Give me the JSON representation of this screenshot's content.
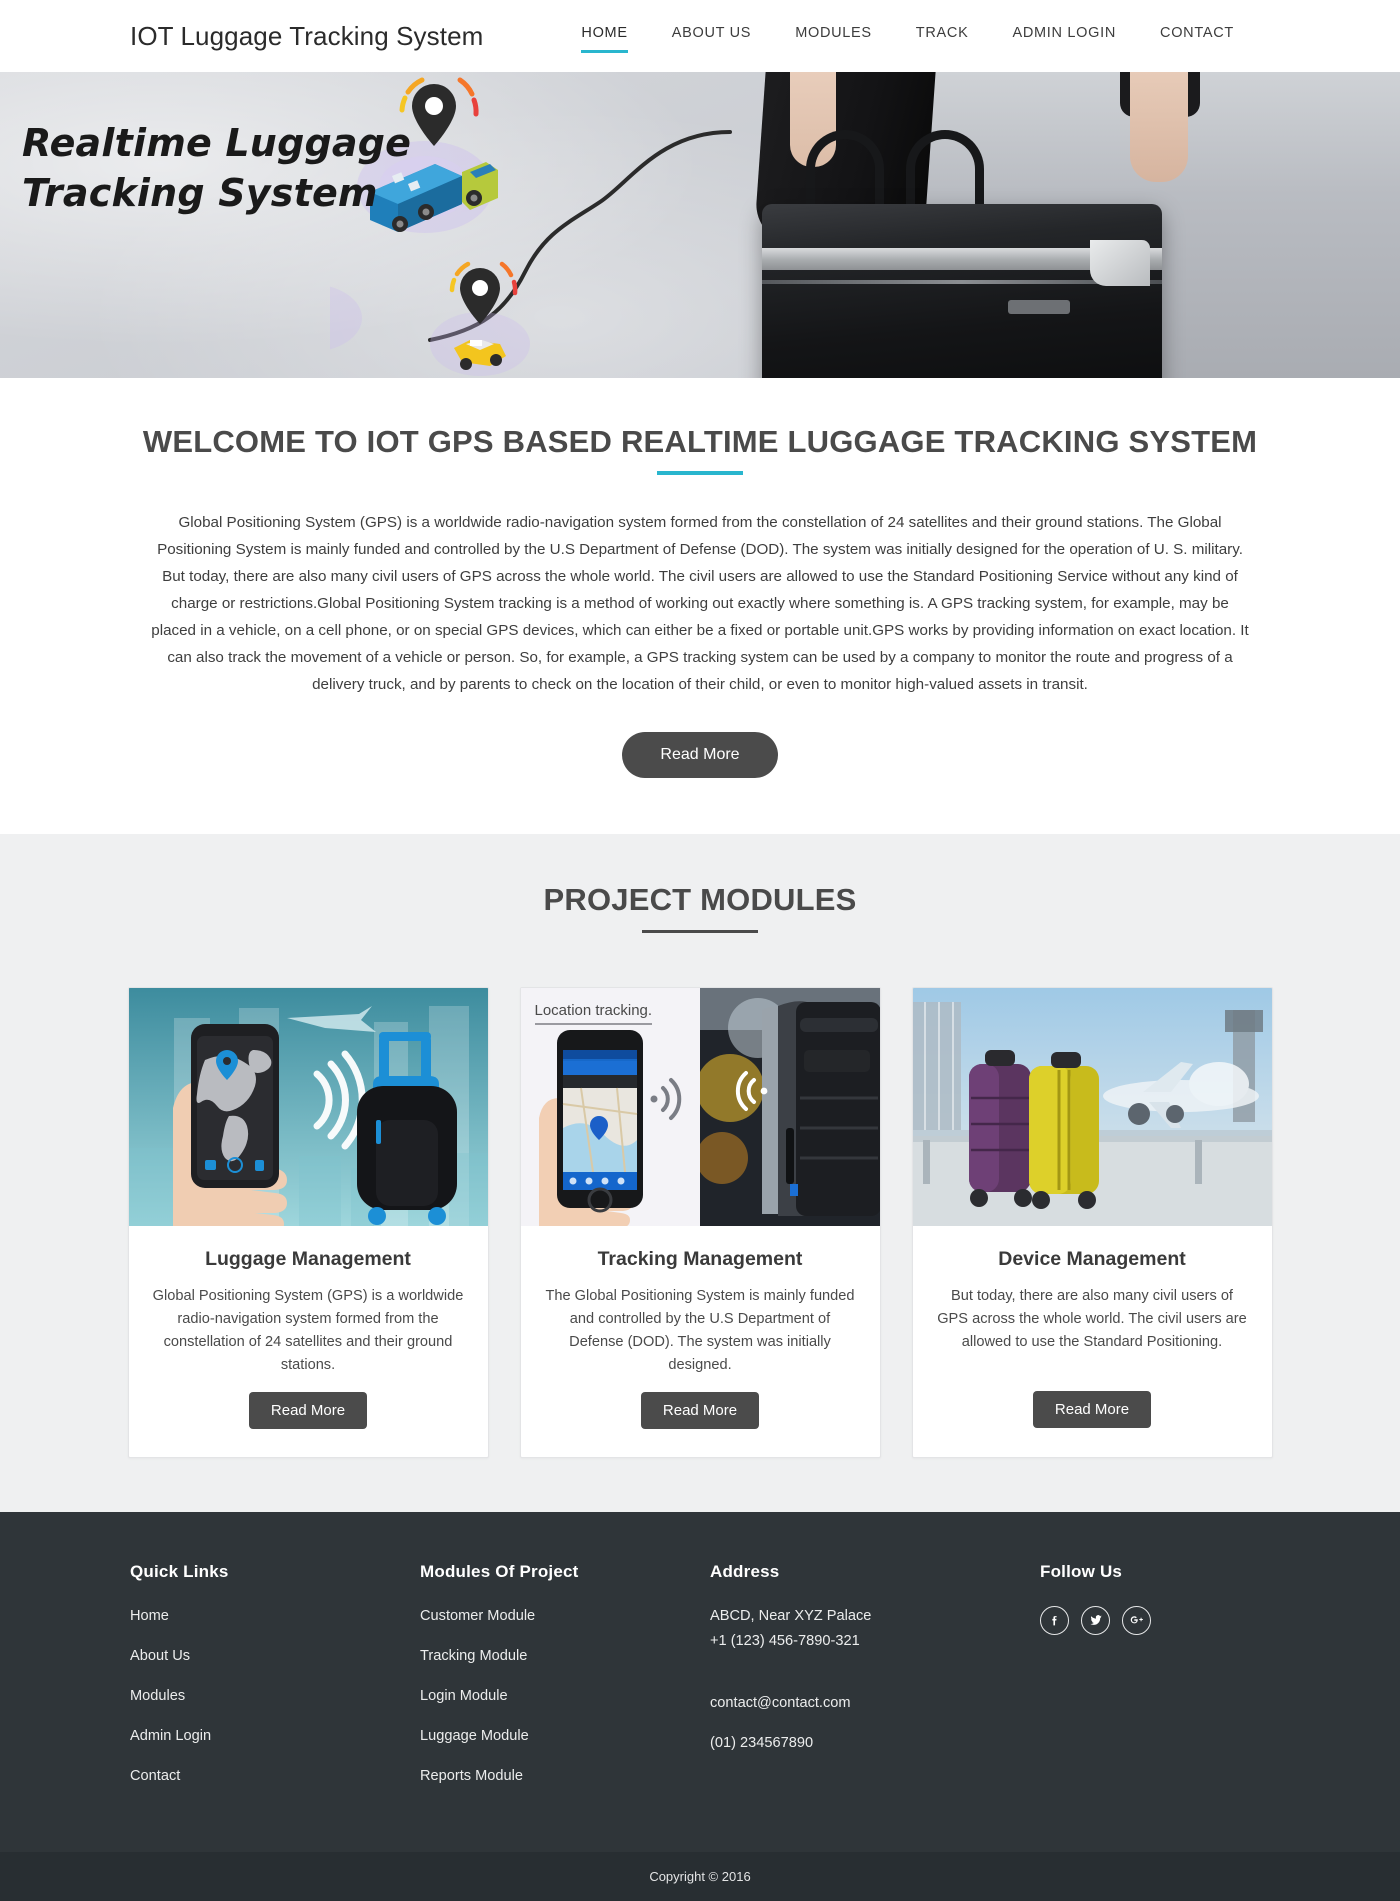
{
  "header": {
    "brand": "IOT Luggage Tracking System",
    "nav": [
      {
        "label": "HOME",
        "active": true
      },
      {
        "label": "ABOUT US",
        "active": false
      },
      {
        "label": "MODULES",
        "active": false
      },
      {
        "label": "TRACK",
        "active": false
      },
      {
        "label": "ADMIN LOGIN",
        "active": false
      },
      {
        "label": "CONTACT",
        "active": false
      }
    ]
  },
  "hero": {
    "title_line1": "Realtime Luggage",
    "title_line2": "Tracking System"
  },
  "welcome": {
    "title": "WELCOME TO IOT GPS BASED REALTIME LUGGAGE TRACKING SYSTEM",
    "body": "Global Positioning System (GPS) is a worldwide radio-navigation system formed from the constellation of 24 satellites and their ground stations. The Global Positioning System is mainly funded and controlled by the U.S Department of Defense (DOD). The system was initially designed for the operation of U. S. military. But today, there are also many civil users of GPS across the whole world. The civil users are allowed to use the Standard Positioning Service without any kind of charge or restrictions.Global Positioning System tracking is a method of working out exactly where something is. A GPS tracking system, for example, may be placed in a vehicle, on a cell phone, or on special GPS devices, which can either be a fixed or portable unit.GPS works by providing information on exact location. It can also track the movement of a vehicle or person. So, for example, a GPS tracking system can be used by a company to monitor the route and progress of a delivery truck, and by parents to check on the location of their child, or even to monitor high-valued assets in transit.",
    "read_more": "Read More"
  },
  "modules": {
    "title": "PROJECT MODULES",
    "cards": [
      {
        "title": "Luggage Management",
        "text": "Global Positioning System (GPS) is a worldwide radio-navigation system formed from the constellation of 24 satellites and their ground stations.",
        "button": "Read More",
        "image_name": "phone-map-and-black-suitcase-illustration"
      },
      {
        "title": "Tracking Management",
        "text": "The Global Positioning System is mainly funded and controlled by the U.S Department of Defense (DOD). The system was initially designed.",
        "button": "Read More",
        "image_name": "location-tracking-phone-and-suitcase-photo",
        "image_caption": "Location tracking."
      },
      {
        "title": "Device Management",
        "text": "But today, there are also many civil users of GPS across the whole world. The civil users are allowed to use the Standard Positioning.",
        "button": "Read More",
        "image_name": "two-suitcases-at-airport-photo"
      }
    ]
  },
  "footer": {
    "quick_links": {
      "heading": "Quick Links",
      "items": [
        "Home",
        "About Us",
        "Modules",
        "Admin Login",
        "Contact"
      ]
    },
    "project_modules": {
      "heading": "Modules Of Project",
      "items": [
        "Customer Module",
        "Tracking Module",
        "Login Module",
        "Luggage Module",
        "Reports Module"
      ]
    },
    "address": {
      "heading": "Address",
      "line1": "ABCD, Near XYZ Palace",
      "line2": "+1 (123) 456-7890-321",
      "email": "contact@contact.com",
      "phone": "(01) 234567890"
    },
    "follow": {
      "heading": "Follow Us",
      "socials": [
        "facebook-icon",
        "twitter-icon",
        "google-plus-icon"
      ]
    },
    "copyright": "Copyright © 2016"
  },
  "colors": {
    "accent_teal": "#29b6ce",
    "button_dark": "#4b4b4b",
    "footer_bg": "#2f3539",
    "copybar_bg": "#282e32",
    "modules_bg": "#eff0f1"
  }
}
